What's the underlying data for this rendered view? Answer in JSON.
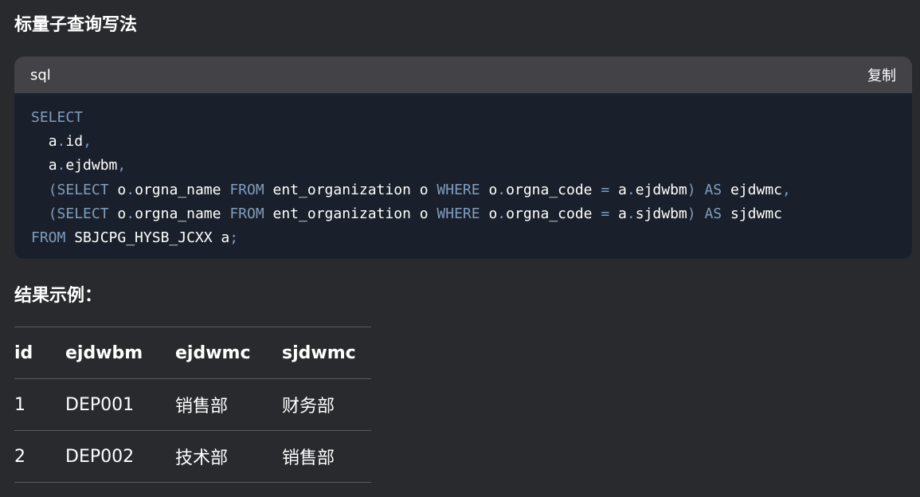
{
  "sections": {
    "scalar_subquery_title": "标量子查询写法",
    "result_example_title": "结果示例："
  },
  "code_block": {
    "language": "sql",
    "copy_label": "复制",
    "lines": [
      [
        {
          "t": "SELECT",
          "k": "kw"
        }
      ],
      [
        {
          "t": "  ",
          "k": "id"
        },
        {
          "t": "a",
          "k": "id"
        },
        {
          "t": ".",
          "k": "op"
        },
        {
          "t": "id",
          "k": "id"
        },
        {
          "t": ",",
          "k": "op"
        }
      ],
      [
        {
          "t": "  ",
          "k": "id"
        },
        {
          "t": "a",
          "k": "id"
        },
        {
          "t": ".",
          "k": "op"
        },
        {
          "t": "ejdwbm",
          "k": "id"
        },
        {
          "t": ",",
          "k": "op"
        }
      ],
      [
        {
          "t": "  ",
          "k": "id"
        },
        {
          "t": "(",
          "k": "op"
        },
        {
          "t": "SELECT",
          "k": "kw"
        },
        {
          "t": " o",
          "k": "id"
        },
        {
          "t": ".",
          "k": "op"
        },
        {
          "t": "orgna_name ",
          "k": "id"
        },
        {
          "t": "FROM",
          "k": "kw"
        },
        {
          "t": " ent_organization o ",
          "k": "id"
        },
        {
          "t": "WHERE",
          "k": "kw"
        },
        {
          "t": " o",
          "k": "id"
        },
        {
          "t": ".",
          "k": "op"
        },
        {
          "t": "orgna_code ",
          "k": "id"
        },
        {
          "t": "=",
          "k": "op"
        },
        {
          "t": " a",
          "k": "id"
        },
        {
          "t": ".",
          "k": "op"
        },
        {
          "t": "ejdwbm",
          "k": "id"
        },
        {
          "t": ")",
          "k": "op"
        },
        {
          "t": " ",
          "k": "id"
        },
        {
          "t": "AS",
          "k": "kw"
        },
        {
          "t": " ejdwmc",
          "k": "id"
        },
        {
          "t": ",",
          "k": "op"
        }
      ],
      [
        {
          "t": "  ",
          "k": "id"
        },
        {
          "t": "(",
          "k": "op"
        },
        {
          "t": "SELECT",
          "k": "kw"
        },
        {
          "t": " o",
          "k": "id"
        },
        {
          "t": ".",
          "k": "op"
        },
        {
          "t": "orgna_name ",
          "k": "id"
        },
        {
          "t": "FROM",
          "k": "kw"
        },
        {
          "t": " ent_organization o ",
          "k": "id"
        },
        {
          "t": "WHERE",
          "k": "kw"
        },
        {
          "t": " o",
          "k": "id"
        },
        {
          "t": ".",
          "k": "op"
        },
        {
          "t": "orgna_code ",
          "k": "id"
        },
        {
          "t": "=",
          "k": "op"
        },
        {
          "t": " a",
          "k": "id"
        },
        {
          "t": ".",
          "k": "op"
        },
        {
          "t": "sjdwbm",
          "k": "id"
        },
        {
          "t": ")",
          "k": "op"
        },
        {
          "t": " ",
          "k": "id"
        },
        {
          "t": "AS",
          "k": "kw"
        },
        {
          "t": " sjdwmc",
          "k": "id"
        }
      ],
      [
        {
          "t": "FROM",
          "k": "kw"
        },
        {
          "t": " SBJCPG_HYSB_JCXX a",
          "k": "id"
        },
        {
          "t": ";",
          "k": "op"
        }
      ]
    ]
  },
  "result_table": {
    "headers": [
      "id",
      "ejdwbm",
      "ejdwmc",
      "sjdwmc"
    ],
    "rows": [
      [
        "1",
        "DEP001",
        "销售部",
        "财务部"
      ],
      [
        "2",
        "DEP002",
        "技术部",
        "销售部"
      ]
    ]
  },
  "colors": {
    "page_background": "#292a2d",
    "code_background": "#1a202b",
    "code_header_background": "#434347",
    "keyword": "#7f9cbd",
    "text": "#ffffff",
    "table_rule": "#5a5b5e"
  }
}
